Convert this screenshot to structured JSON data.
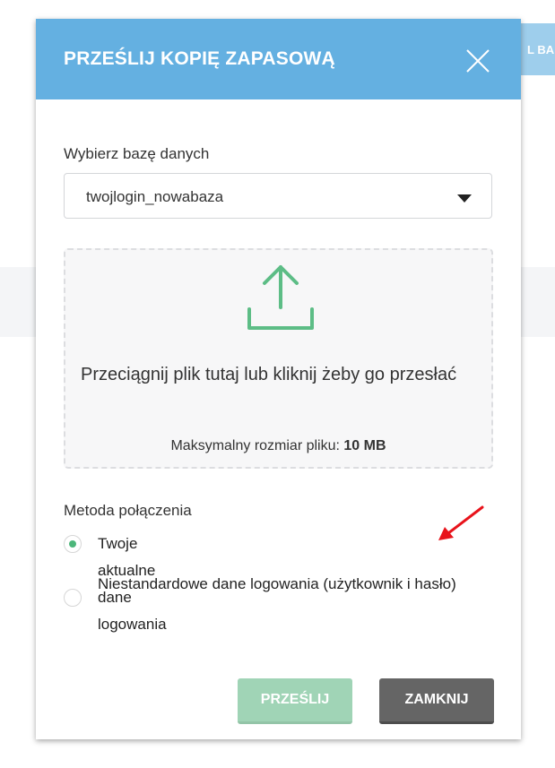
{
  "background": {
    "button_label": "L BA"
  },
  "modal": {
    "title": "PRZEŚLIJ KOPIĘ ZAPASOWĄ",
    "header_color": "#64b0e1"
  },
  "database": {
    "label": "Wybierz bazę danych",
    "selected": "twojlogin_nowabaza"
  },
  "dropzone": {
    "text": "Przeciągnij plik tutaj lub kliknij żeby go przesłać",
    "max_size_label": "Maksymalny rozmiar pliku:",
    "max_size_value": "10 MB",
    "icon": "upload-icon",
    "icon_color": "#5dbd86"
  },
  "connection_method": {
    "label": "Metoda połączenia",
    "options": [
      {
        "label": "Twoje aktualne dane logowania",
        "checked": true
      },
      {
        "label": "Niestandardowe dane logowania (użytkownik i hasło)",
        "checked": false
      }
    ]
  },
  "buttons": {
    "send": "PRZEŚLIJ",
    "close": "ZAMKNIJ"
  },
  "annotation": {
    "arrow_color": "#e8131b"
  }
}
